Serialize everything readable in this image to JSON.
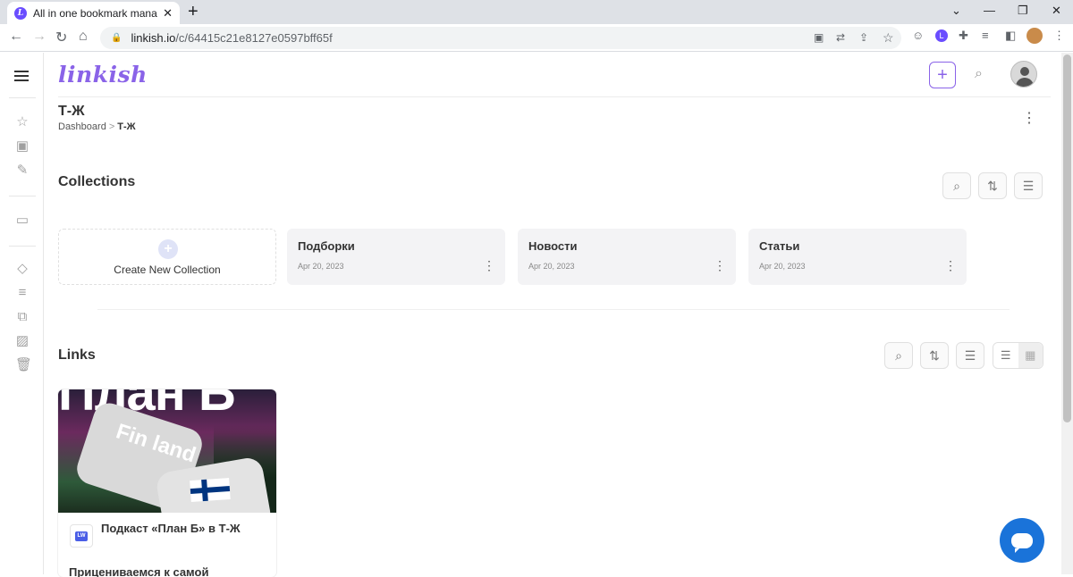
{
  "browser": {
    "tab_title": "All in one bookmark manager | Li",
    "tab_favicon": "L",
    "url_host": "linkish.io",
    "url_path": "/c/64415c21e8127e0597bff65f"
  },
  "header": {
    "logo": "linkish",
    "add_icon": "+"
  },
  "page": {
    "title": "Т-Ж",
    "breadcrumb_root": "Dashboard",
    "breadcrumb_sep": ">",
    "breadcrumb_current": "Т-Ж"
  },
  "collections": {
    "heading": "Collections",
    "create_label": "Create New Collection",
    "items": [
      {
        "name": "Подборки",
        "date": "Apr 20, 2023"
      },
      {
        "name": "Новости",
        "date": "Apr 20, 2023"
      },
      {
        "name": "Статьи",
        "date": "Apr 20, 2023"
      }
    ]
  },
  "links": {
    "heading": "Links",
    "items": [
      {
        "thumb_big_text": "План Б",
        "thumb_key_text": "Fin land",
        "favicon": "LW",
        "title": "Подкаст «План Б» в Т-Ж",
        "description": "Прицениваемся к самой"
      }
    ]
  },
  "colors": {
    "brand": "#8a63e8",
    "chat": "#1a73d9"
  }
}
